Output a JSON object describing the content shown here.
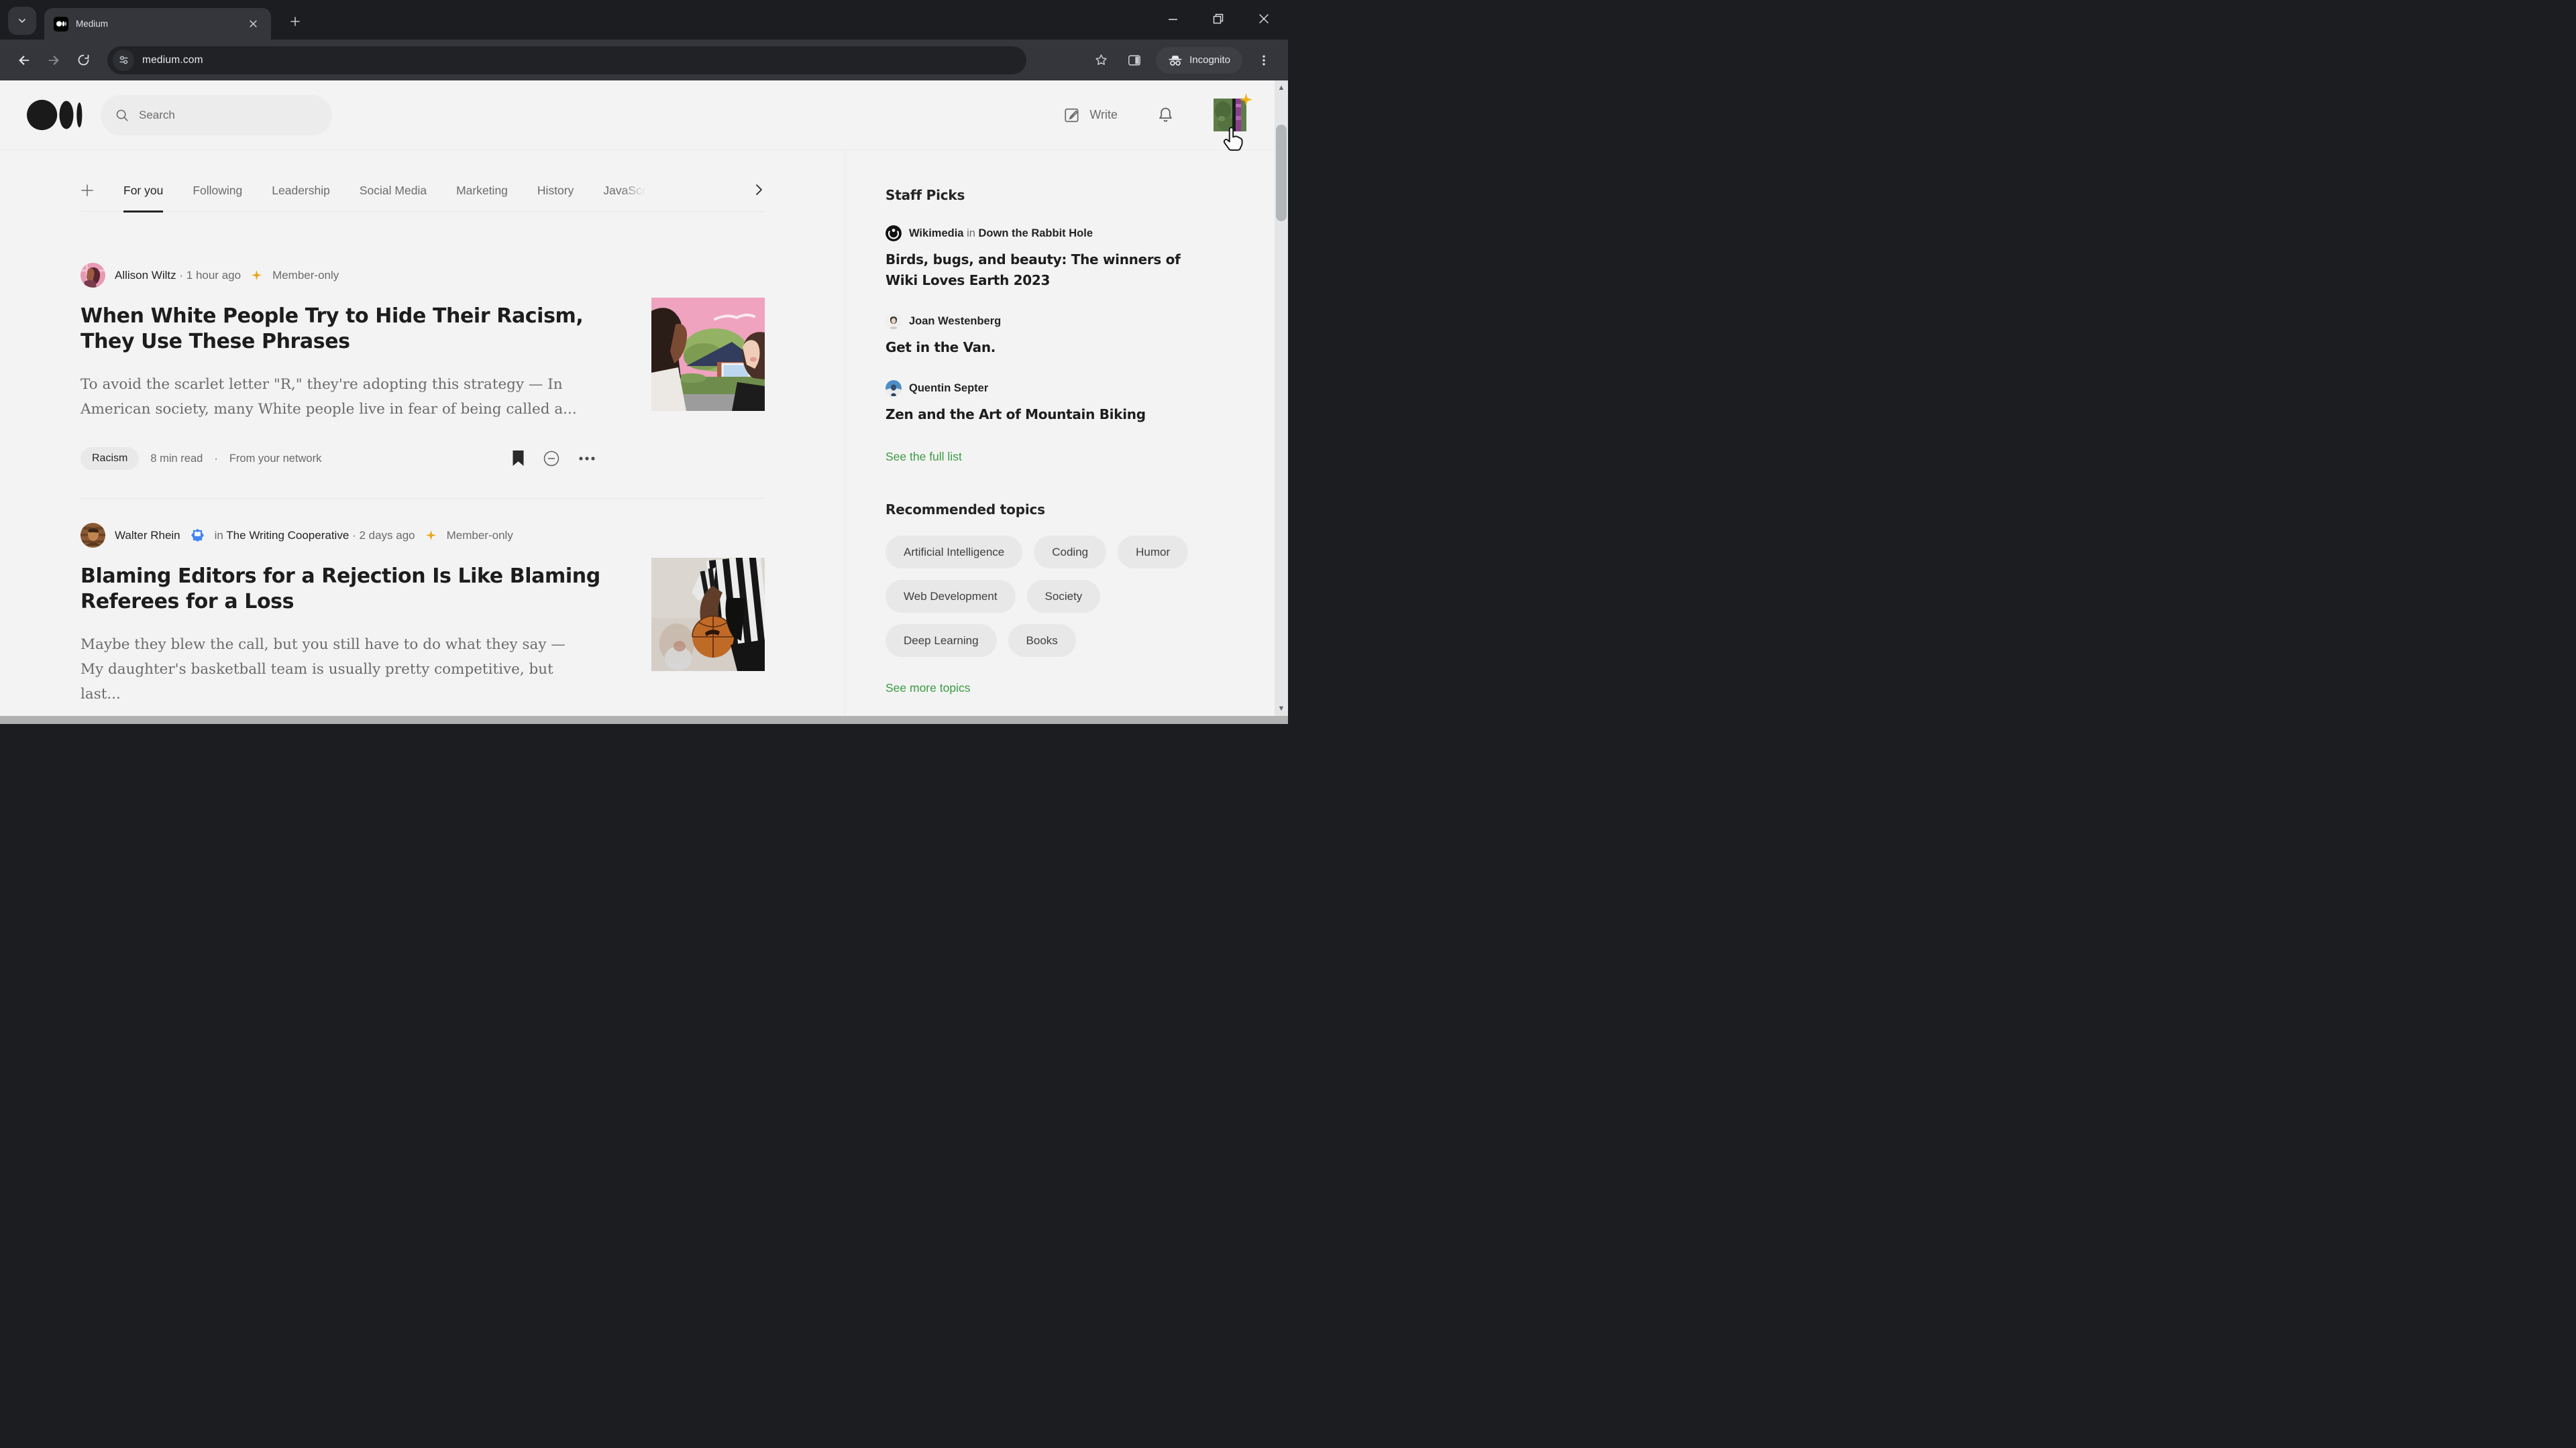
{
  "ui": {
    "dot": "·"
  },
  "colors": {
    "accent_green": "#3b9b42",
    "member_gold": "#e7a817",
    "badge_blue": "#4285f4"
  },
  "browser": {
    "tab_title": "Medium",
    "url": "medium.com",
    "incognito_label": "Incognito"
  },
  "header": {
    "search_placeholder": "Search",
    "write_label": "Write"
  },
  "feed_tabs": {
    "items": [
      "For you",
      "Following",
      "Leadership",
      "Social Media",
      "Marketing",
      "History",
      "JavaScript"
    ],
    "active": "For you"
  },
  "articles": [
    {
      "author": "Allison Wiltz",
      "time": "1 hour ago",
      "badge": "Member-only",
      "title": "When White People Try to Hide Their Racism, They Use These Phrases",
      "excerpt": "To avoid the scarlet letter \"R,\" they're adopting this strategy — In American society, many White people live in fear of being called a...",
      "tag": "Racism",
      "read_time": "8 min read",
      "source": "From your network"
    },
    {
      "author": "Walter Rhein",
      "in_word": "in",
      "publication": "The Writing Cooperative",
      "time": "2 days ago",
      "badge": "Member-only",
      "title": "Blaming Editors for a Rejection Is Like Blaming Referees for a Loss",
      "excerpt": "Maybe they blew the call, but you still have to do what they say — My daughter's basketball team is usually pretty competitive, but last..."
    }
  ],
  "sidebar": {
    "staff_picks_title": "Staff Picks",
    "picks": [
      {
        "author": "Wikimedia",
        "in_word": "in",
        "publication": "Down the Rabbit Hole",
        "title": "Birds, bugs, and beauty: The winners of Wiki Loves Earth 2023"
      },
      {
        "author": "Joan Westenberg",
        "title": "Get in the Van."
      },
      {
        "author": "Quentin Septer",
        "title": "Zen and the Art of Mountain Biking"
      }
    ],
    "see_full_list": "See the full list",
    "recommended_title": "Recommended topics",
    "topics": [
      "Artificial Intelligence",
      "Coding",
      "Humor",
      "Web Development",
      "Society",
      "Deep Learning",
      "Books"
    ],
    "see_more_topics": "See more topics"
  }
}
